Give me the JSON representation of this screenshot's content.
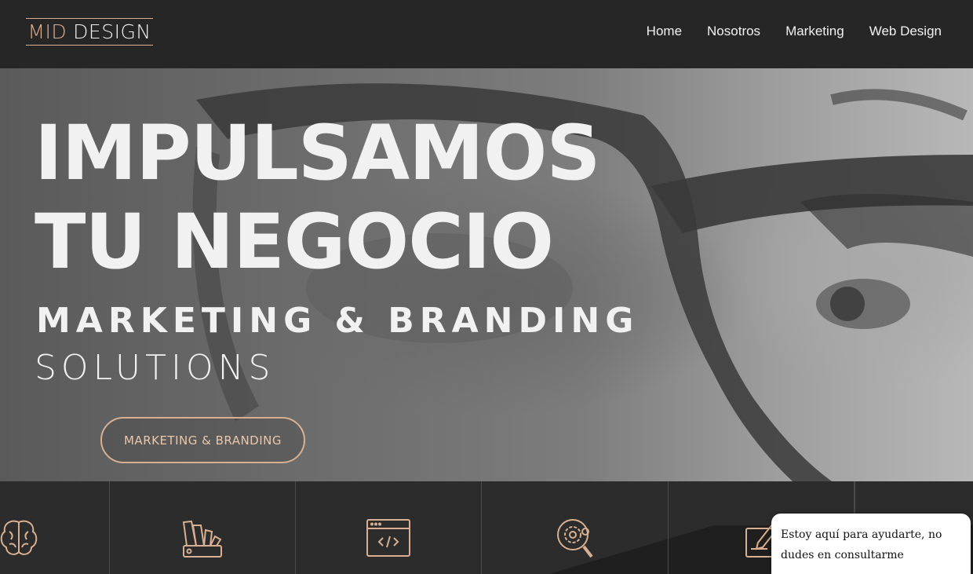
{
  "brand": {
    "logo_part1": "MID",
    "logo_part2": "DESIGN"
  },
  "nav": {
    "items": [
      "Home",
      "Nosotros",
      "Marketing",
      "Web Design"
    ]
  },
  "hero": {
    "title_line1": "IMPULSAMOS",
    "title_line2": "TU NEGOCIO",
    "subtitle_line1": "MARKETING & BRANDING",
    "subtitle_line2": "SOLUTIONS",
    "cta_label": "MARKETING & BRANDING"
  },
  "services": {
    "icons": [
      "brain-icon",
      "color-swatch-icon",
      "code-window-icon",
      "gear-search-icon",
      "edit-document-icon"
    ]
  },
  "chat": {
    "message": "Estoy aquí para ayudarte, no dudes en consultarme"
  },
  "colors": {
    "accent": "#d8b091",
    "nav_bg": "#262626",
    "strip_bg": "#2c2c2c",
    "text": "#f1f1f1"
  }
}
